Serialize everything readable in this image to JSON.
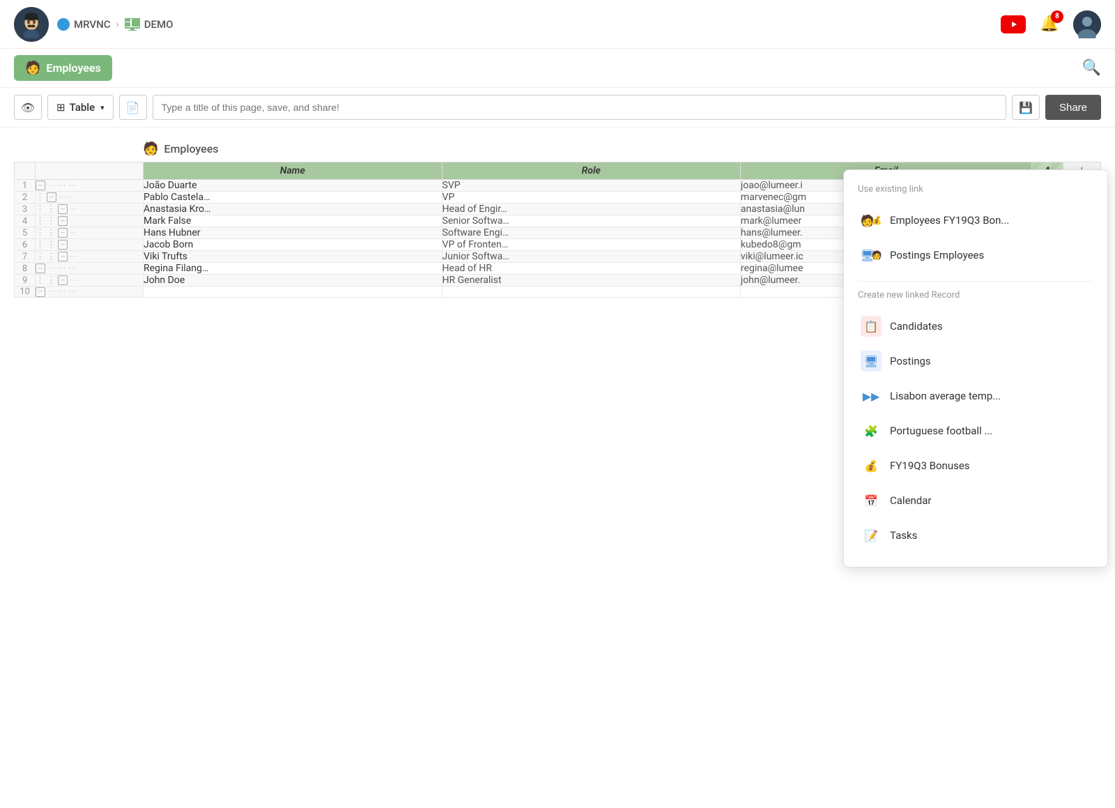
{
  "header": {
    "logo_emoji": "🧔",
    "mrvnc_label": "MRVNC",
    "demo_label": "DEMO",
    "notif_count": "8"
  },
  "toolbar": {
    "employees_tab_label": "Employees",
    "view_label": "Table",
    "title_placeholder": "Type a title of this page, save, and share!",
    "share_label": "Share"
  },
  "table": {
    "section_label": "Employees",
    "columns": [
      "Name",
      "Role",
      "Email",
      "A"
    ],
    "rows": [
      {
        "num": "1",
        "name": "João Duarte",
        "role": "SVP",
        "email": "joao@lumeer.i"
      },
      {
        "num": "2",
        "name": "Pablo Castela…",
        "role": "VP",
        "email": "marvenec@gm"
      },
      {
        "num": "3",
        "name": "Anastasia Kro…",
        "role": "Head of Engir…",
        "email": "anastasia@lun"
      },
      {
        "num": "4",
        "name": "Mark False",
        "role": "Senior Softwa…",
        "email": "mark@lumeer"
      },
      {
        "num": "5",
        "name": "Hans Hubner",
        "role": "Software Engi…",
        "email": "hans@lumeer."
      },
      {
        "num": "6",
        "name": "Jacob Born",
        "role": "VP of Fronten…",
        "email": "kubedo8@gm"
      },
      {
        "num": "7",
        "name": "Viki Trufts",
        "role": "Junior Softwa…",
        "email": "viki@lumeer.ic"
      },
      {
        "num": "8",
        "name": "Regina Filang…",
        "role": "Head of HR",
        "email": "regina@lumee"
      },
      {
        "num": "9",
        "name": "John Doe",
        "role": "HR Generalist",
        "email": "john@lumeer."
      },
      {
        "num": "10",
        "name": "",
        "role": "",
        "email": ""
      }
    ]
  },
  "popup": {
    "existing_link_title": "Use existing link",
    "existing_items": [
      {
        "label": "Employees FY19Q3 Bon...",
        "icon_type": "employees-postings"
      },
      {
        "label": "Postings Employees",
        "icon_type": "postings-employees"
      }
    ],
    "new_link_title": "Create new linked Record",
    "new_items": [
      {
        "label": "Candidates",
        "icon": "📋",
        "icon_color": "red"
      },
      {
        "label": "Postings",
        "icon": "🖥",
        "icon_color": "blue"
      },
      {
        "label": "Lisabon average temp...",
        "icon": "▶▶",
        "icon_color": "blue"
      },
      {
        "label": "Portuguese football ...",
        "icon": "🧩",
        "icon_color": "purple"
      },
      {
        "label": "FY19Q3 Bonuses",
        "icon": "💰",
        "icon_color": "orange"
      },
      {
        "label": "Calendar",
        "icon": "📅",
        "icon_color": "teal"
      },
      {
        "label": "Tasks",
        "icon": "📝",
        "icon_color": "dark"
      }
    ]
  }
}
